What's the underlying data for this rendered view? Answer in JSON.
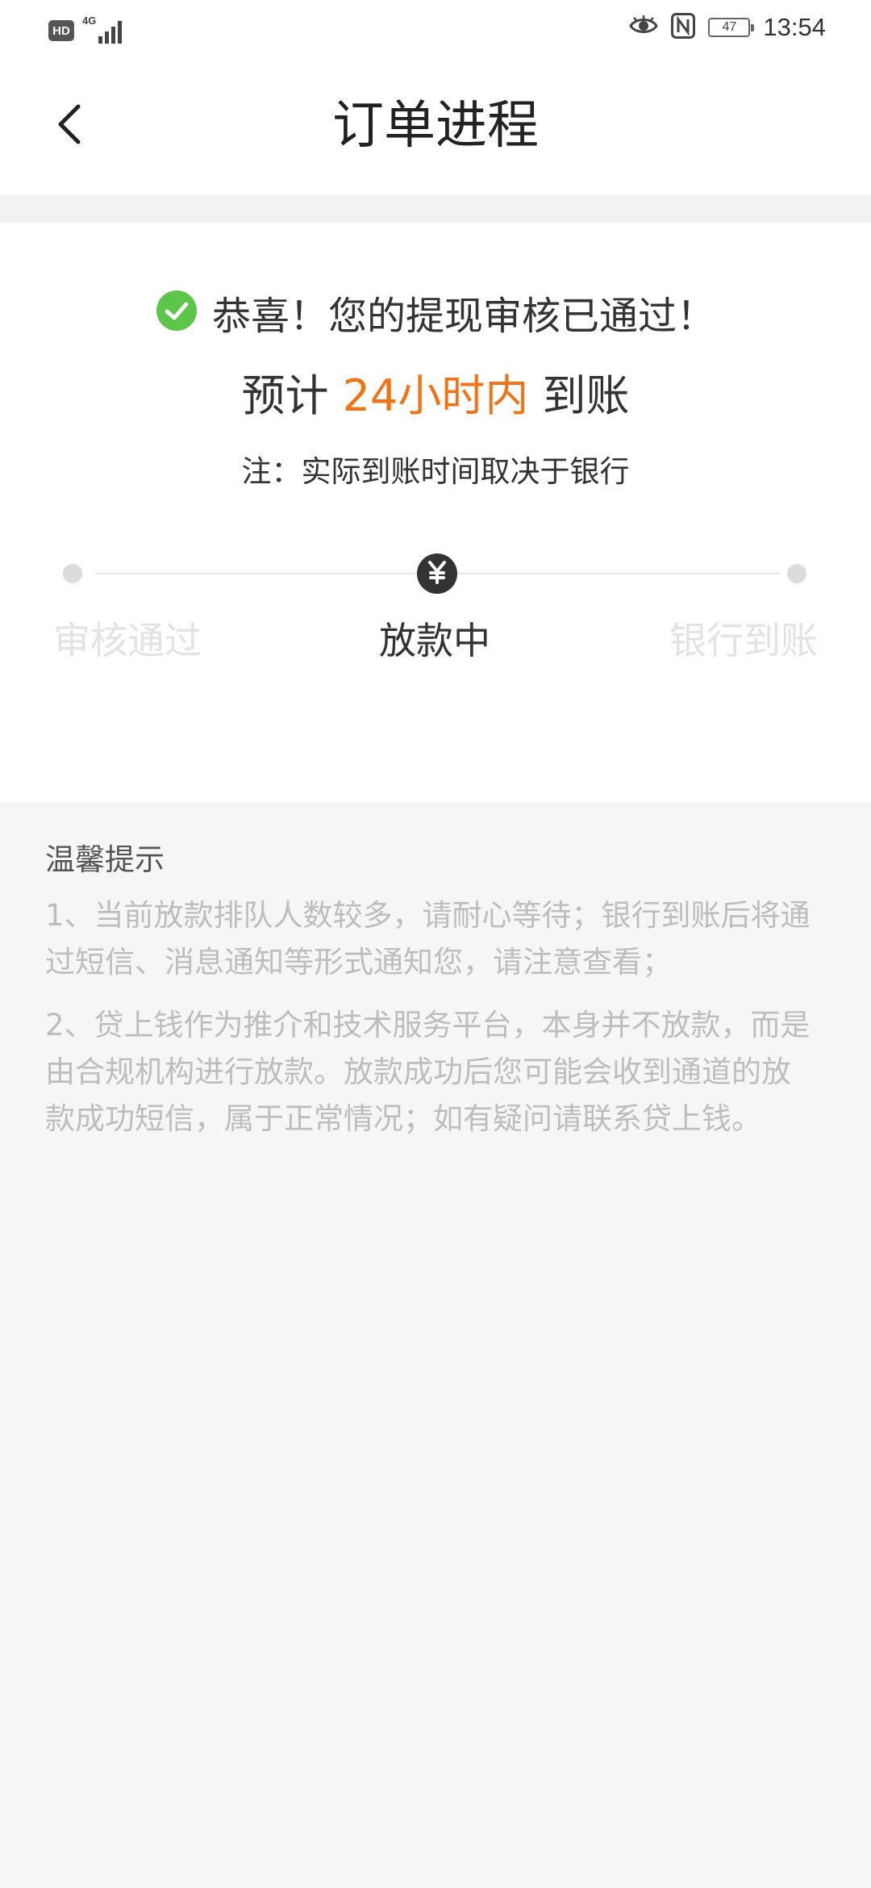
{
  "status_bar": {
    "hd_label": "HD",
    "network_label": "4G",
    "battery_level": "47",
    "time": "13:54",
    "icons": [
      "signal-icon",
      "eye-icon",
      "nfc-icon",
      "battery-icon"
    ]
  },
  "nav": {
    "back_icon": "chevron-left-icon",
    "title": "订单进程"
  },
  "status_card": {
    "success_icon": "check-circle-icon",
    "success_text": "恭喜！您的提现审核已通过！",
    "eta_prefix": "预计 ",
    "eta_highlight": "24小时内",
    "eta_suffix": " 到账",
    "note": "注：实际到账时间取决于银行",
    "steps": [
      {
        "label": "审核通过",
        "state": "done"
      },
      {
        "label": "放款中",
        "state": "current",
        "icon": "yen-icon"
      },
      {
        "label": "银行到账",
        "state": "pending"
      }
    ]
  },
  "tips": {
    "title": "温馨提示",
    "items": [
      "1、当前放款排队人数较多，请耐心等待；银行到账后将通过短信、消息通知等形式通知您，请注意查看；",
      "2、贷上钱作为推介和技术服务平台，本身并不放款，而是由合规机构进行放款。放款成功后您可能会收到通道的放款成功短信，属于正常情况；如有疑问请联系贷上钱。"
    ]
  },
  "colors": {
    "accent_orange": "#f07417",
    "success_green": "#5cc54a",
    "active_step": "#333333",
    "inactive_step": "#e3e3e3",
    "tips_text": "#bdbdbd",
    "page_background": "#f6f6f6"
  }
}
